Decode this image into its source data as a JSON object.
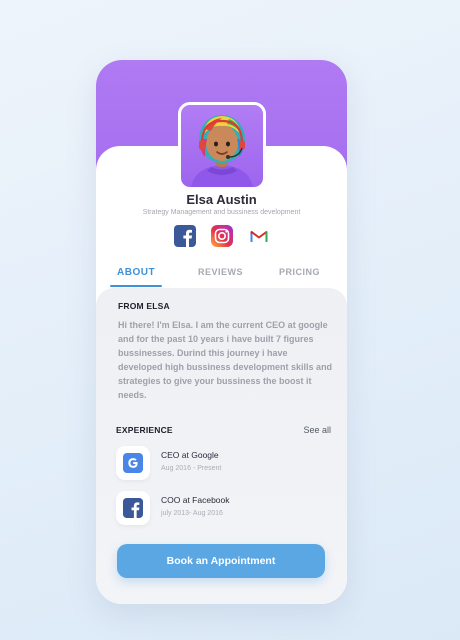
{
  "profile": {
    "name": "Elsa Austin",
    "subtitle": "Strategy Management and bussiness development"
  },
  "socials": [
    {
      "icon": "facebook-icon",
      "color": "#3b5998"
    },
    {
      "icon": "instagram-icon",
      "color": "#d6249f"
    },
    {
      "icon": "gmail-icon",
      "color": "#d93025"
    }
  ],
  "tabs": [
    {
      "label": "ABOUT",
      "active": true
    },
    {
      "label": "REVIEWS",
      "active": false
    },
    {
      "label": "PRICING",
      "active": false
    }
  ],
  "about": {
    "heading": "FROM ELSA",
    "text": "Hi there! I'm Elsa. I am the current CEO at google and for the past 10 years i have built 7 figures bussinesses. Durind this journey i have developed high bussiness development skills and strategies to give your bussiness the boost it needs."
  },
  "experience": {
    "heading": "EXPERIENCE",
    "see_all": "See all",
    "items": [
      {
        "title": "CEO at Google",
        "dates": "Aug 2016 - Present",
        "icon": "google-icon"
      },
      {
        "title": "COO at Facebook",
        "dates": "july 2013- Aug 2016",
        "icon": "facebook-icon"
      }
    ]
  },
  "cta": {
    "label": "Book an Appointment"
  },
  "colors": {
    "header": "#a66ff0",
    "accent": "#3e92d8",
    "button": "#5aa7e4",
    "facebook": "#3b5998"
  }
}
